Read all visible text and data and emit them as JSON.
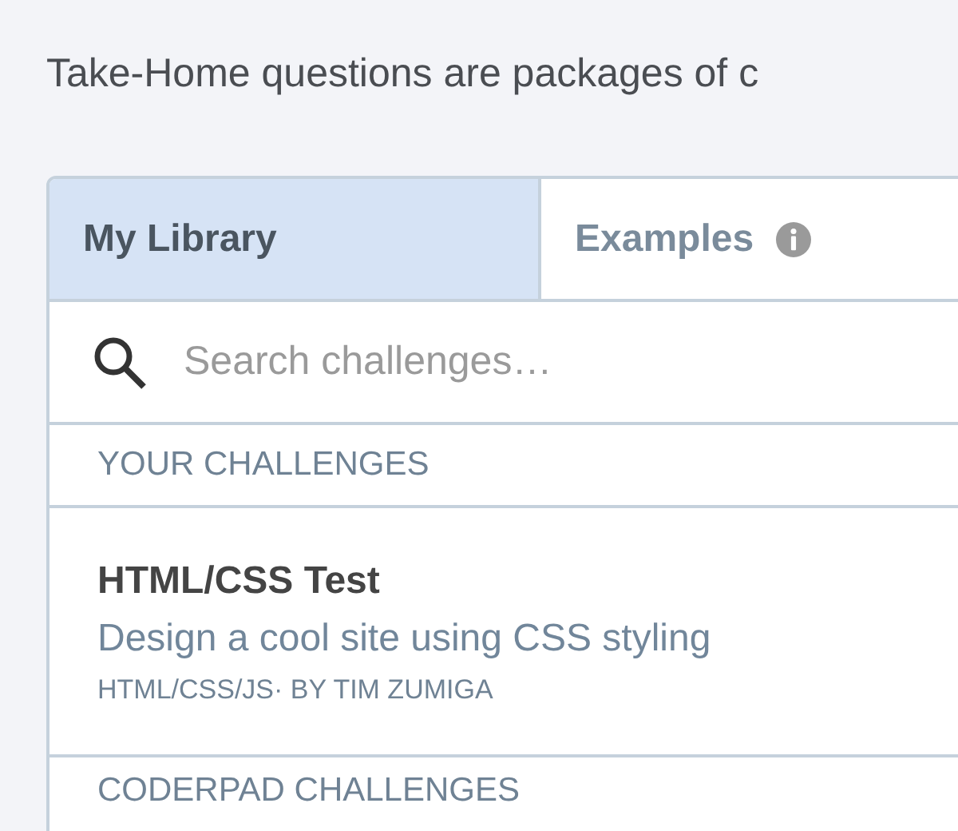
{
  "intro": "Take-Home questions are packages of c",
  "tabs": [
    {
      "label": "My Library",
      "selected": true,
      "info": false
    },
    {
      "label": "Examples",
      "selected": false,
      "info": true
    }
  ],
  "search": {
    "placeholder": "Search challenges…"
  },
  "sections": [
    {
      "title": "YOUR CHALLENGES",
      "items": [
        {
          "title": "HTML/CSS Test",
          "description": "Design a cool site using CSS styling",
          "meta": "HTML/CSS/JS· BY TIM ZUMIGA"
        }
      ]
    },
    {
      "title": "CODERPAD CHALLENGES"
    }
  ]
}
